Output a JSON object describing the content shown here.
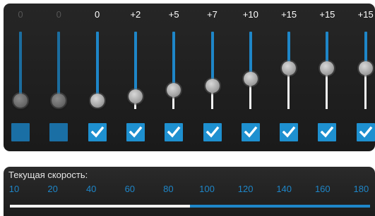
{
  "equalizer": {
    "accent_color": "#1e86c8",
    "bands": [
      {
        "value_label": "0",
        "level": 0,
        "enabled": false
      },
      {
        "value_label": "0",
        "level": 0,
        "enabled": false
      },
      {
        "value_label": "0",
        "level": 0,
        "enabled": true
      },
      {
        "value_label": "+2",
        "level": 2,
        "enabled": true
      },
      {
        "value_label": "+5",
        "level": 5,
        "enabled": true
      },
      {
        "value_label": "+7",
        "level": 7,
        "enabled": true
      },
      {
        "value_label": "+10",
        "level": 10,
        "enabled": true
      },
      {
        "value_label": "+15",
        "level": 15,
        "enabled": true
      },
      {
        "value_label": "+15",
        "level": 15,
        "enabled": true
      },
      {
        "value_label": "+15",
        "level": 15,
        "enabled": true
      }
    ],
    "level_max": 15,
    "check_icon": "checkmark-icon"
  },
  "speed": {
    "title": "Текущая скорость:",
    "ticks": [
      "10",
      "20",
      "40",
      "60",
      "80",
      "100",
      "120",
      "140",
      "160",
      "180"
    ],
    "current_fraction": 0.5
  }
}
